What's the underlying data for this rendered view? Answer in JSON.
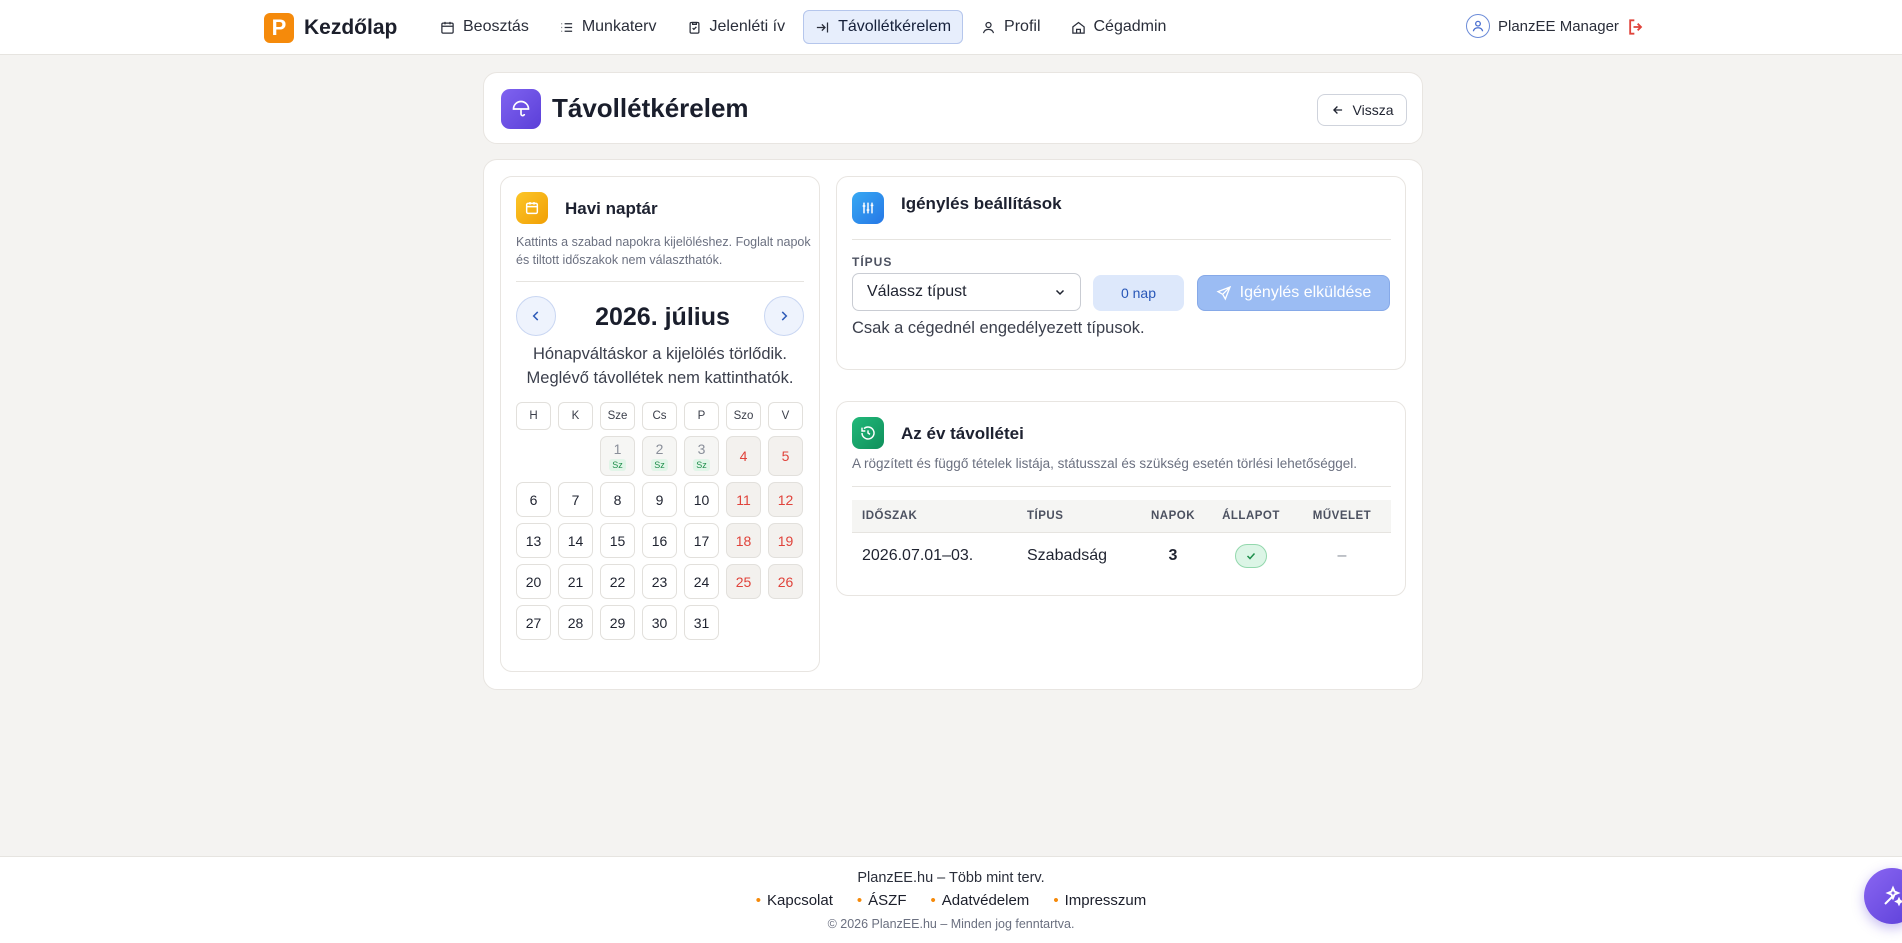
{
  "nav": {
    "brand": "Kezdőlap",
    "brand_logo_letter": "P",
    "items": [
      {
        "label": "Beosztás",
        "icon": "calendar-icon"
      },
      {
        "label": "Munkaterv",
        "icon": "list-icon"
      },
      {
        "label": "Jelenléti ív",
        "icon": "clipboard-icon"
      },
      {
        "label": "Távollétkérelem",
        "icon": "enter-icon",
        "active": true
      },
      {
        "label": "Profil",
        "icon": "user-icon"
      },
      {
        "label": "Cégadmin",
        "icon": "home-icon"
      }
    ],
    "user_name": "PlanzEE Manager"
  },
  "page": {
    "title": "Távollétkérelem",
    "back_label": "Vissza"
  },
  "calendar": {
    "title": "Havi naptár",
    "description": "Kattints a szabad napokra kijelöléshez. Foglalt napok és tiltott időszakok nem választhatók.",
    "month_label": "2026. július",
    "hint": "Hónapváltáskor a kijelölés törlődik. Meglévő távollétek nem kattinthatók.",
    "weekdays": [
      "H",
      "K",
      "Sze",
      "Cs",
      "P",
      "Szo",
      "V"
    ],
    "booked_tag": "Sz",
    "days": {
      "1": "1",
      "2": "2",
      "3": "3",
      "4": "4",
      "5": "5",
      "6": "6",
      "7": "7",
      "8": "8",
      "9": "9",
      "10": "10",
      "11": "11",
      "12": "12",
      "13": "13",
      "14": "14",
      "15": "15",
      "16": "16",
      "17": "17",
      "18": "18",
      "19": "19",
      "20": "20",
      "21": "21",
      "22": "22",
      "23": "23",
      "24": "24",
      "25": "25",
      "26": "26",
      "27": "27",
      "28": "28",
      "29": "29",
      "30": "30",
      "31": "31"
    }
  },
  "settings": {
    "title": "Igénylés beállítások",
    "type_label": "TÍPUS",
    "type_placeholder": "Válassz típust",
    "days_count": "0 nap",
    "submit_label": "Igénylés elküldése",
    "note": "Csak a cégednél engedélyezett típusok."
  },
  "absences": {
    "title": "Az év távollétei",
    "description": "A rögzített és függő tételek listája, státusszal és szükség esetén törlési lehetőséggel.",
    "columns": [
      "IDŐSZAK",
      "TÍPUS",
      "NAPOK",
      "ÁLLAPOT",
      "MŰVELET"
    ],
    "rows": [
      {
        "period": "2026.07.01–03.",
        "type": "Szabadság",
        "days": "3",
        "status": "approved",
        "action": "–"
      }
    ]
  },
  "footer": {
    "brand": "PlanzEE.hu – Több mint terv.",
    "links": [
      "Kapcsolat",
      "ÁSZF",
      "Adatvédelem",
      "Impresszum"
    ],
    "copyright": "© 2026 PlanzEE.hu – Minden jog fenntartva."
  },
  "colors": {
    "accent": "#f58a0b",
    "primary": "#5b3fd8",
    "weekend": "#e0433b",
    "approved": "#1f8f4c"
  }
}
